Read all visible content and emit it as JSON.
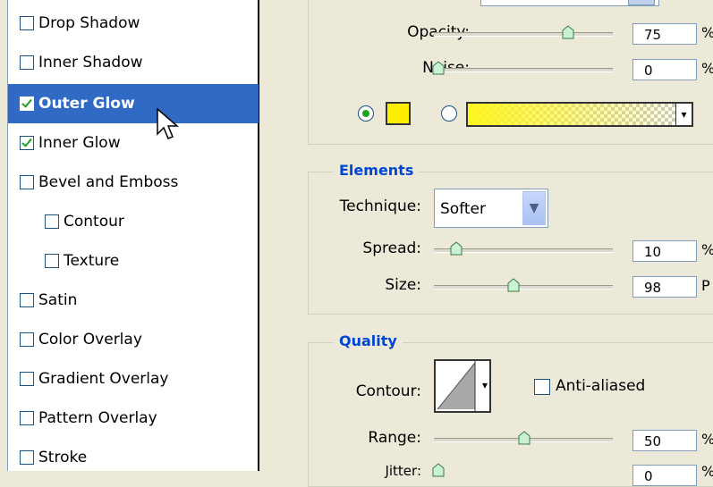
{
  "sidebar": {
    "items": [
      {
        "label": "Drop Shadow",
        "checked": false,
        "selected": false,
        "indent": false
      },
      {
        "label": "Inner Shadow",
        "checked": false,
        "selected": false,
        "indent": false
      },
      {
        "label": "Outer Glow",
        "checked": true,
        "selected": true,
        "indent": false
      },
      {
        "label": "Inner Glow",
        "checked": true,
        "selected": false,
        "indent": false
      },
      {
        "label": "Bevel and Emboss",
        "checked": false,
        "selected": false,
        "indent": false
      },
      {
        "label": "Contour",
        "checked": false,
        "selected": false,
        "indent": true
      },
      {
        "label": "Texture",
        "checked": false,
        "selected": false,
        "indent": true
      },
      {
        "label": "Satin",
        "checked": false,
        "selected": false,
        "indent": false
      },
      {
        "label": "Color Overlay",
        "checked": false,
        "selected": false,
        "indent": false
      },
      {
        "label": "Gradient Overlay",
        "checked": false,
        "selected": false,
        "indent": false
      },
      {
        "label": "Pattern Overlay",
        "checked": false,
        "selected": false,
        "indent": false
      },
      {
        "label": "Stroke",
        "checked": false,
        "selected": false,
        "indent": false
      }
    ]
  },
  "structure": {
    "opacity_label": "Opacity:",
    "opacity_value": "75",
    "opacity_unit": "%",
    "opacity_level": 0.75,
    "noise_label": "Noise:",
    "noise_value": "0",
    "noise_unit": "%",
    "noise_level": 0,
    "color_swatch": "#ffee00",
    "gradient_fg": "#fff51e"
  },
  "elements": {
    "title": "Elements",
    "technique_label": "Technique:",
    "technique_value": "Softer",
    "spread_label": "Spread:",
    "spread_value": "10",
    "spread_unit": "%",
    "spread_level": 0.1,
    "size_label": "Size:",
    "size_value": "98",
    "size_unit": "P",
    "size_level": 0.39
  },
  "quality": {
    "title": "Quality",
    "contour_label": "Contour:",
    "anti_aliased_label": "Anti-aliased",
    "range_label": "Range:",
    "range_value": "50",
    "range_unit": "%",
    "range_level": 0.5,
    "jitter_label": "Jitter:",
    "jitter_value": "0",
    "jitter_unit": "%"
  },
  "colors": {
    "selection": "#316ac5",
    "group_title": "#0046d5",
    "dialog_bg": "#ece9d8"
  }
}
